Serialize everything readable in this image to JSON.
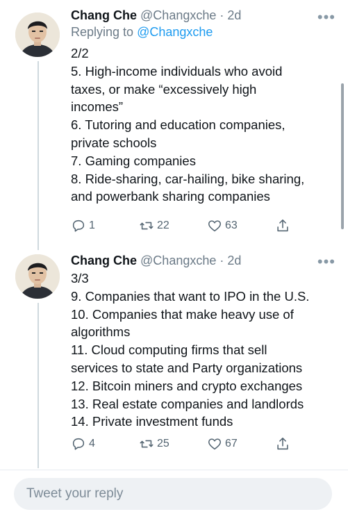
{
  "tweets": [
    {
      "author_name": "Chang Che",
      "handle": "@Changxche",
      "separator": "·",
      "time": "2d",
      "more": "•••",
      "replying_prefix": "Replying to",
      "replying_to": "@Changxche",
      "lines": [
        "2/2",
        "5. High-income individuals who avoid",
        "taxes, or make “excessively high",
        "incomes”",
        "6. Tutoring and education companies,",
        "private schools",
        "7. Gaming companies",
        "8. Ride-sharing, car-hailing, bike sharing,",
        "and powerbank sharing companies"
      ],
      "reply_count": "1",
      "retweet_count": "22",
      "like_count": "63"
    },
    {
      "author_name": "Chang Che",
      "handle": "@Changxche",
      "separator": "·",
      "time": "2d",
      "more": "•••",
      "lines": [
        "3/3",
        "9. Companies that want to IPO in the U.S.",
        "10. Companies that make heavy use of",
        "algorithms",
        "11. Cloud computing firms that sell",
        "services to state and Party organizations",
        "12. Bitcoin miners and crypto exchanges",
        "13. Real estate companies and landlords",
        "14. Private investment funds"
      ],
      "reply_count": "4",
      "retweet_count": "25",
      "like_count": "67"
    }
  ],
  "reply_box": {
    "placeholder": "Tweet your reply"
  },
  "icons": {
    "reply": "reply-icon",
    "retweet": "retweet-icon",
    "like": "heart-icon",
    "share": "share-icon",
    "more": "more-icon"
  },
  "colors": {
    "link": "#1d9bf0",
    "secondary": "#6b7a87",
    "thread_line": "#cfd9de"
  }
}
